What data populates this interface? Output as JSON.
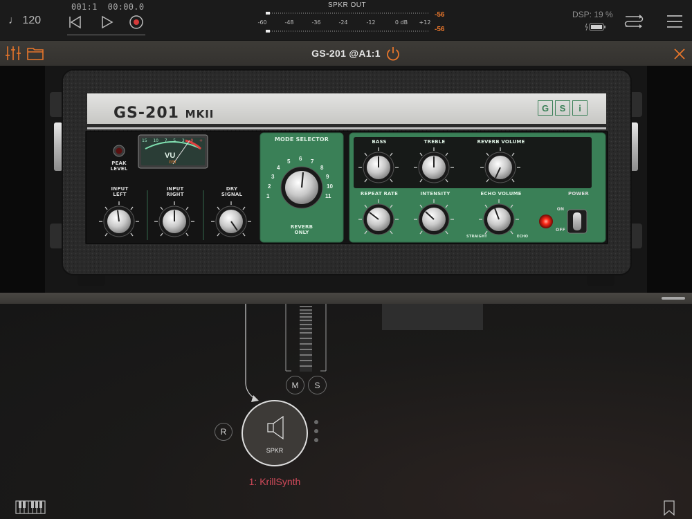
{
  "transport": {
    "tempo": "♩ 120",
    "position": "001:1  00:00.0"
  },
  "meter": {
    "title": "SPKR OUT",
    "scale": [
      "-60",
      "-48",
      "-36",
      "-24",
      "-12",
      "0 dB",
      "+12"
    ],
    "peak_left": "-56",
    "peak_right": "-56"
  },
  "status": {
    "dsp": "DSP: 19 %"
  },
  "plugin": {
    "title": "GS-201 @A1:1"
  },
  "amp": {
    "model_main": "GS-201",
    "model_sub": "MKII",
    "logo": [
      "G",
      "S",
      "i"
    ],
    "vu_label": "VU",
    "vu_brand": "GSI",
    "vu_scale": [
      "15",
      "10",
      "7",
      "5",
      "3",
      "0",
      "+"
    ],
    "peak_level_label": "PEAK\nLEVEL",
    "input_left_label": "INPUT\nLEFT",
    "input_right_label": "INPUT\nRIGHT",
    "dry_signal_label": "DRY\nSIGNAL",
    "mode_selector_label": "MODE SELECTOR",
    "mode_numbers": [
      "1",
      "2",
      "3",
      "4",
      "5",
      "6",
      "7",
      "8",
      "9",
      "10",
      "11"
    ],
    "reverb_only_label": "REVERB\nONLY",
    "bass_label": "BASS",
    "treble_label": "TREBLE",
    "reverb_volume_label": "REVERB VOLUME",
    "repeat_rate_label": "REPEAT RATE",
    "intensity_label": "INTENSITY",
    "echo_volume_label": "ECHO VOLUME",
    "straight_label": "STRAIGHT",
    "echo_label": "ECHO",
    "power_label": "POWER",
    "on_label": "ON",
    "off_label": "OFF"
  },
  "routing": {
    "mute_label": "M",
    "solo_label": "S",
    "record_label": "R",
    "node_label": "SPKR",
    "channel_name": "1: KrillSynth"
  },
  "colors": {
    "accent": "#e8762b",
    "amp_green": "#3a8057",
    "channel_name": "#d24a5a"
  }
}
